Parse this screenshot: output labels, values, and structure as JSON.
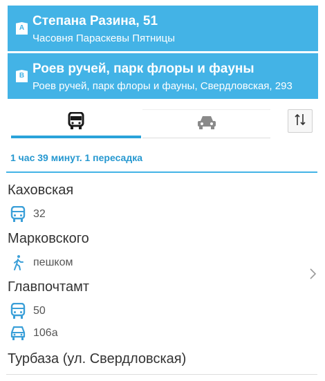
{
  "from": {
    "badge": "A",
    "title": "Степана Разина, 51",
    "subtitle": "Часовня Параскевы Пятницы"
  },
  "to": {
    "badge": "B",
    "title": "Роев ручей, парк флоры и фауны",
    "subtitle": "Роев ручей, парк флоры и фауны, Свердловская, 293"
  },
  "modes": [
    {
      "icon": "bus-icon",
      "selected": true
    },
    {
      "icon": "car-icon",
      "selected": false
    }
  ],
  "swap_icon": "swap-icon",
  "summary": "1 час 39 минут. 1 пересадка",
  "route": {
    "stops": [
      "Каховская",
      "Марковского",
      "Главпочтамт",
      "Турбаза (ул. Свердловская)"
    ],
    "legs": [
      {
        "icon": "bus-icon",
        "label": "32"
      },
      {
        "icon": "walk-icon",
        "label": "пешком"
      },
      {
        "icon": "bus-icon",
        "label": "50"
      },
      {
        "icon": "minibus-icon",
        "label": "106а"
      }
    ]
  },
  "colors": {
    "accent": "#43b3e6",
    "summary_text": "#2698d0",
    "icon_blue": "#3a9fd8"
  }
}
